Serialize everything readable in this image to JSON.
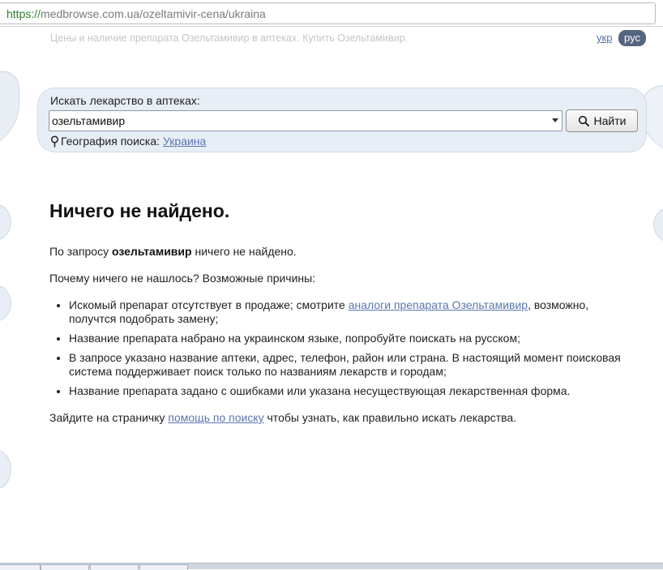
{
  "browser": {
    "url_scheme": "https://",
    "url_rest": "medbrowse.com.ua/ozeltamivir-cena/ukraina"
  },
  "header": {
    "tagline": "Цены и наличие препарата Озельтамивир в аптеках. Купить Озельтамивир.",
    "lang_ukr": "укр",
    "lang_rus": "рус"
  },
  "search": {
    "label": "Искать лекарство в аптеках:",
    "value": "озельтамивир",
    "button_label": "Найти",
    "geo_label": "География поиска:",
    "geo_value": "Украина"
  },
  "result": {
    "heading": "Ничего не найдено.",
    "query_prefix": "По запросу",
    "query_term": "озельтамивир",
    "query_suffix": "ничего не найдено.",
    "reasons_intro": "Почему ничего не нашлось? Возможные причины:",
    "reason1_prefix": "Искомый препарат отсутствует в продаже; смотрите",
    "reason1_link": "аналоги препарата Озельтамивир",
    "reason1_suffix": ", возможно, получтся подобрать замену;",
    "reason2": "Название препарата набрано на украинском языке, попробуйте поискать на русском;",
    "reason3": "В запросе указано название аптеки, адрес, телефон, район или страна. В настоящий момент поисковая система поддерживает поиск только по названиям лекарств и городам;",
    "reason4": "Название препарата задано с ошибками или указана несуществующая лекарственная форма.",
    "help_prefix": "Зайдите на страничку",
    "help_link": "помощь по поиску",
    "help_suffix": "чтобы узнать, как правильно искать лекарства."
  },
  "colors": {
    "link": "#5a76b0",
    "panel_bg": "#e8eef6",
    "active_lang_bg": "#55657f"
  }
}
